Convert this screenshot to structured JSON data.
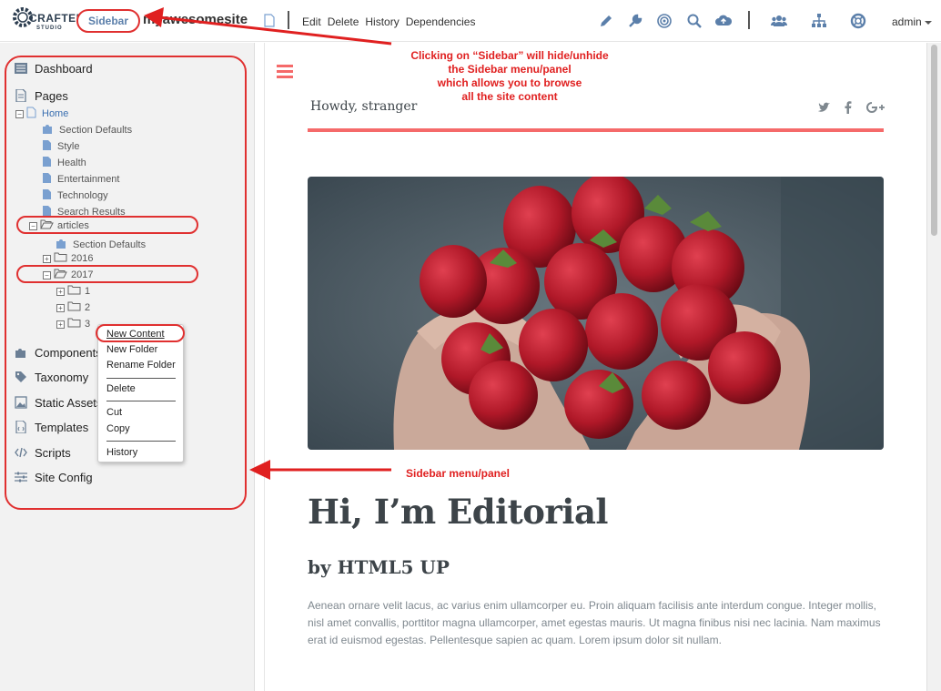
{
  "brand": {
    "logo_word": "CRAFTER",
    "logo_sub": "STUDIO"
  },
  "header": {
    "sidebar_toggle": "Sidebar",
    "site_name": "myawesomesite",
    "menu": [
      "Edit",
      "Delete",
      "History",
      "Dependencies"
    ],
    "tools": [
      "pencil-icon",
      "wrench-icon",
      "target-icon",
      "search-icon",
      "cloud-upload-icon",
      "users-icon",
      "sitemap-icon",
      "help-icon"
    ],
    "user": "admin"
  },
  "sidebar": {
    "nav": [
      {
        "label": "Dashboard",
        "icon": "dashboard-icon"
      },
      {
        "label": "Pages",
        "icon": "pages-icon"
      },
      {
        "label": "Components",
        "icon": "puzzle-icon"
      },
      {
        "label": "Taxonomy",
        "icon": "tag-icon"
      },
      {
        "label": "Static Assets",
        "icon": "image-icon"
      },
      {
        "label": "Templates",
        "icon": "template-icon"
      },
      {
        "label": "Scripts",
        "icon": "code-icon"
      },
      {
        "label": "Site Config",
        "icon": "sliders-icon"
      }
    ],
    "tree": {
      "home": "Home",
      "home_children": [
        "Section Defaults",
        "Style",
        "Health",
        "Entertainment",
        "Technology",
        "Search Results"
      ],
      "articles": "articles",
      "articles_children": [
        "Section Defaults",
        "2016"
      ],
      "year": "2017",
      "year_children": [
        "1",
        "2",
        "3"
      ]
    }
  },
  "context_menu": {
    "items": [
      "New Content",
      "New Folder",
      "Rename Folder",
      "Delete",
      "Cut",
      "Copy",
      "History"
    ]
  },
  "preview": {
    "greeting": "Howdy, stranger",
    "social": [
      "twitter-icon",
      "facebook-icon",
      "google-plus-icon"
    ],
    "heading": "Hi, I’m Editorial",
    "subheading": "by HTML5 UP",
    "paragraph": "Aenean ornare velit lacus, ac varius enim ullamcorper eu. Proin aliquam facilisis ante interdum congue. Integer mollis, nisl amet convallis, porttitor magna ullamcorper, amet egestas mauris. Ut magna finibus nisi nec lacinia. Nam maximus erat id euismod egestas. Pellentesque sapien ac quam. Lorem ipsum dolor sit nullam."
  },
  "annotations": {
    "toggle_note": [
      "Clicking on “Sidebar” will hide/unhide",
      "the Sidebar menu/panel",
      "which allows you to browse",
      "all the site content"
    ],
    "panel_note": "Sidebar menu/panel"
  },
  "colors": {
    "annotation": "#e02020",
    "accent": "#f56a6a",
    "link": "#3a6fb0"
  }
}
